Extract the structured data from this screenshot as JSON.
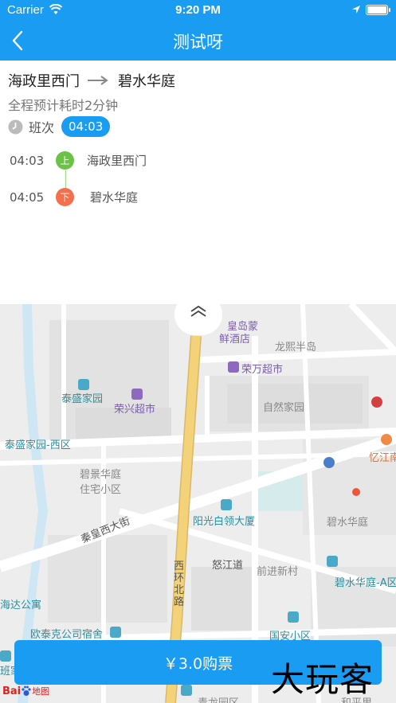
{
  "status_bar": {
    "carrier": "Carrier",
    "time": "9:20 PM"
  },
  "nav": {
    "title": "测试呀"
  },
  "route": {
    "origin": "海政里西门",
    "destination": "碧水华庭",
    "duration": "全程预计耗时2分钟",
    "shift_label": "班次",
    "shift_time": "04:03"
  },
  "stops": [
    {
      "time": "04:03",
      "badge": "上",
      "name": "海政里西门"
    },
    {
      "time": "04:05",
      "badge": "下",
      "name": "碧水华庭"
    }
  ],
  "map": {
    "labels": {
      "huangdaomeng": "皇岛蒙",
      "xianjiudian": "鲜酒店",
      "longxi": "龙熙半岛",
      "rongwan": "荣万超市",
      "taisheng": "泰盛家园",
      "rongxing": "荣兴超市",
      "ziran": "自然家园",
      "taisheng_west": "泰盛家园-西区",
      "yijing1": "碧景华庭",
      "yijing2": "住宅小区",
      "yixing": "忆江南",
      "yangguang": "阳光白领大厦",
      "bishui": "碧水华庭",
      "qinhuang": "秦皇西大街",
      "xihuan": "西环北路",
      "nujiang": "怒江道",
      "qianjin": "前进新村",
      "bishui_a": "碧水华庭-A区",
      "haida": "海达公寓",
      "outaike": "欧泰克公司宿舍",
      "guoan": "国安小区",
      "qinglong": "青龙园区",
      "heping": "和平里",
      "banjia": "班家"
    },
    "baidu": "Bai",
    "baidu_map": "地图"
  },
  "buy_button": "￥3.0购票",
  "watermark": "大玩客",
  "colors": {
    "primary": "#1a9cf3",
    "board": "#6cc247",
    "alight": "#f36f4d",
    "road_main": "#f3d27a"
  }
}
